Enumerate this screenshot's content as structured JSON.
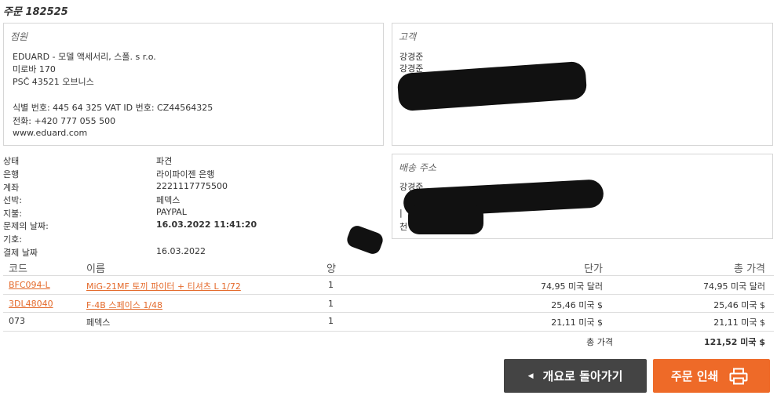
{
  "order_title": "주문 182525",
  "seller": {
    "heading": "점원",
    "lines": [
      "EDUARD - 모델 액세서리, 스폴. s r.o.",
      "미로바 170",
      "PSČ 43521 오브니스",
      "식별 번호: 445 64 325 VAT ID 번호: CZ44564325",
      "전화: +420 777 055 500",
      "www.eduard.com"
    ]
  },
  "customer": {
    "heading": "고객",
    "name1": "강경준",
    "name2": "강경준"
  },
  "shipping": {
    "heading": "배송 주소",
    "name": "강경준",
    "partial1": "|",
    "partial2": "천"
  },
  "details": [
    {
      "label": "상태",
      "value": "파견"
    },
    {
      "label": "은행",
      "value": "라이파이젠 은행"
    },
    {
      "label": "계좌",
      "value": "2221117775500"
    },
    {
      "label": "선박:",
      "value": "페덱스"
    },
    {
      "label": "지불:",
      "value": "PAYPAL"
    },
    {
      "label": "문제의 날짜:",
      "value": "16.03.2022 11:41:20"
    },
    {
      "label": "기호:",
      "value": ""
    },
    {
      "label": "결제 날짜",
      "value": "16.03.2022"
    }
  ],
  "table": {
    "headers": {
      "code": "코드",
      "name": "이름",
      "qty": "양",
      "unit_price": "단가",
      "total_price": "총 가격"
    },
    "rows": [
      {
        "code": "BFC094-L",
        "name": "MiG-21MF 토끼 파이터 + 티셔츠 L 1/72",
        "qty": "1",
        "unit": "74,95 미국 달러",
        "total": "74,95 미국 달러"
      },
      {
        "code": "3DL48040",
        "name": "F-4B 스페이스 1/48",
        "qty": "1",
        "unit": "25,46 미국 $",
        "total": "25,46 미국 $"
      },
      {
        "code": "073",
        "name": "페덱스",
        "qty": "1",
        "unit": "21,11 미국 $",
        "total": "21,11 미국 $"
      }
    ],
    "total_label": "총 가격",
    "total_value": "121,52 미국 $"
  },
  "buttons": {
    "back": "개요로 돌아가기",
    "print": "주문 인쇄"
  },
  "colors": {
    "link": "#e46a2b",
    "print_button": "#ee6a28",
    "back_button": "#444444"
  }
}
